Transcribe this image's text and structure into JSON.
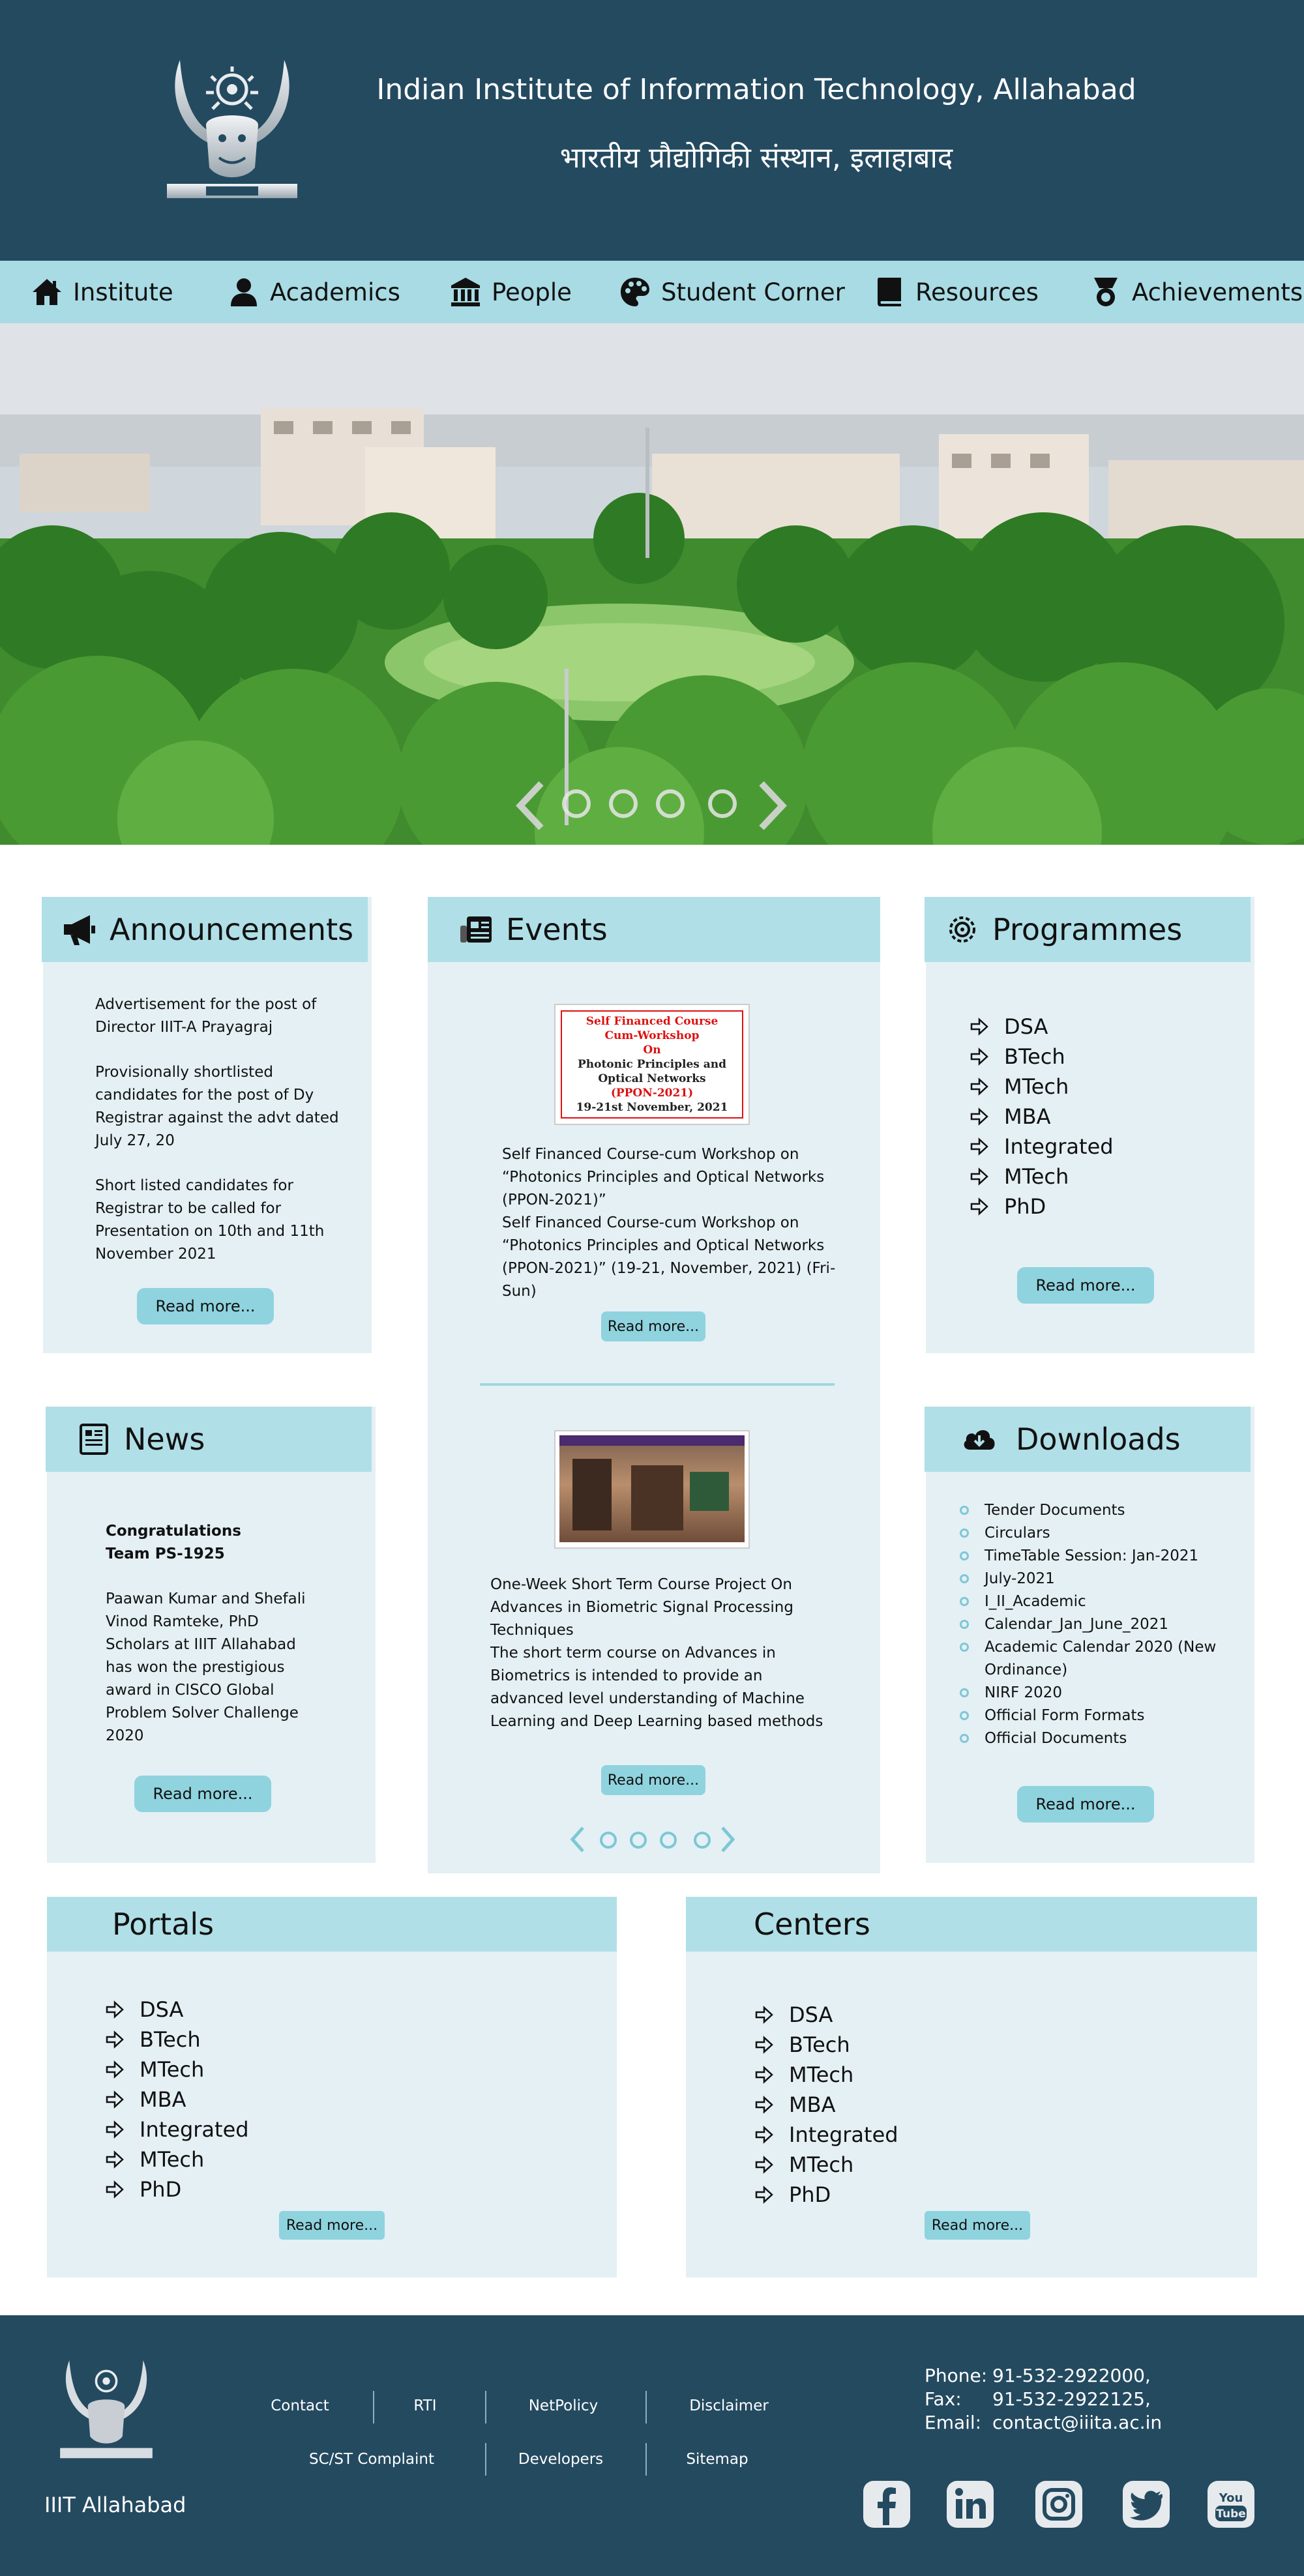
{
  "header": {
    "title_en": "Indian Institute of Information Technology, Allahabad",
    "title_hi": "भारतीय प्रौद्योगिकी संस्थान, इलाहाबाद"
  },
  "nav": {
    "items": [
      {
        "label": "Institute",
        "icon": "home-icon"
      },
      {
        "label": "Academics",
        "icon": "user-icon"
      },
      {
        "label": "People",
        "icon": "building-icon"
      },
      {
        "label": "Student Corner",
        "icon": "palette-icon"
      },
      {
        "label": "Resources",
        "icon": "book-icon"
      },
      {
        "label": "Achievements",
        "icon": "medal-icon"
      }
    ]
  },
  "hero": {
    "slides": 4,
    "active_slide": 1
  },
  "announcements": {
    "title": "Announcements",
    "items": [
      "Advertisement for the post of Director IIIT-A Prayagraj",
      "Provisionally shortlisted candidates for the post of Dy Registrar against the advt dated July 27, 20",
      "Short listed candidates for Registrar to be called for Presentation on 10th and 11th November 2021"
    ],
    "button": "Read more..."
  },
  "events": {
    "title": "Events",
    "event1": {
      "poster_lines": [
        "Self Financed Course",
        "Cum-Workshop",
        "On",
        "Photonic Principles and",
        "Optical Networks",
        "(PPON-2021)",
        "19-21st November, 2021"
      ],
      "text": "Self Financed Course-cum Workshop on “Photonics Principles and Optical Networks (PPON-2021)”\nSelf Financed Course-cum Workshop on “Photonics Principles and Optical Networks (PPON-2021)” (19-21, November, 2021) (Fri-Sun)",
      "button": "Read more..."
    },
    "event2": {
      "text": "One-Week Short Term Course Project On Advances in Biometric Signal Processing Techniques\nThe short term course on Advances in Biometrics is intended to provide an advanced level understanding of Machine Learning and Deep Learning based methods",
      "button": "Read more..."
    },
    "slides": 4
  },
  "programmes": {
    "title": "Programmes",
    "items": [
      "DSA",
      "BTech",
      "MTech",
      "MBA",
      "Integrated",
      "MTech",
      "PhD"
    ],
    "button": "Read more..."
  },
  "news": {
    "title": "News",
    "headline": "Congratulations Team PS-1925",
    "body": "Paawan Kumar and Shefali Vinod Ramteke, PhD Scholars at IIIT Allahabad has won the prestigious award in CISCO Global Problem Solver Challenge 2020",
    "button": "Read more..."
  },
  "downloads": {
    "title": "Downloads",
    "items": [
      "Tender Documents",
      "Circulars",
      "TimeTable Session: Jan-2021",
      "July-2021",
      "I_II_Academic",
      "Calendar_Jan_June_2021",
      "Academic Calendar 2020 (New Ordinance)",
      "NIRF 2020",
      "Official Form Formats",
      "Official Documents"
    ],
    "button": "Read more..."
  },
  "portals": {
    "title": "Portals",
    "items": [
      "DSA",
      "BTech",
      "MTech",
      "MBA",
      "Integrated",
      "MTech",
      "PhD"
    ],
    "button": "Read more..."
  },
  "centers": {
    "title": "Centers",
    "items": [
      "DSA",
      "BTech",
      "MTech",
      "MBA",
      "Integrated",
      "MTech",
      "PhD"
    ],
    "button": "Read more..."
  },
  "footer": {
    "name": "IIIT Allahabad",
    "links_row1": [
      "Contact",
      "RTI",
      "NetPolicy",
      "Disclaimer"
    ],
    "links_row2": [
      "SC/ST Complaint",
      "Developers",
      "Sitemap"
    ],
    "contact": {
      "phone_label": "Phone:",
      "phone": "91-532-2922000,",
      "fax_label": "Fax:",
      "fax": "91-532-2922125,",
      "email_label": "Email:",
      "email": "contact@iiita.ac.in"
    },
    "social": [
      "facebook-icon",
      "linkedin-icon",
      "instagram-icon",
      "twitter-icon",
      "youtube-icon"
    ]
  },
  "colors": {
    "header_bg": "#244a60",
    "nav_bg": "#a8dbe4",
    "card_bg": "#e4f0f4",
    "card_head_bg": "#b0dfe7",
    "button_bg": "#8fd3de"
  }
}
